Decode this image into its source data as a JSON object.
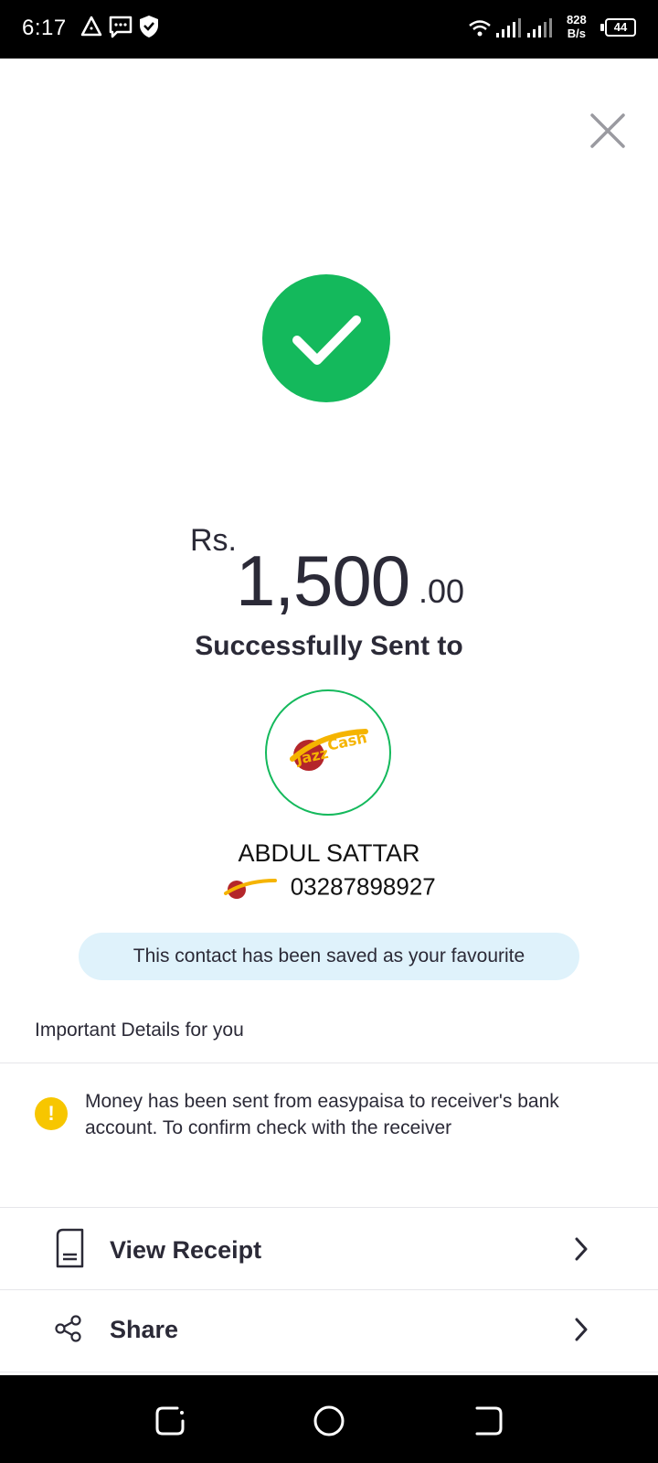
{
  "status_bar": {
    "time": "6:17",
    "net_speed_value": "828",
    "net_speed_unit": "B/s",
    "battery": "44"
  },
  "icons": {
    "close": "close-icon",
    "success": "checkmark-icon",
    "receipt": "receipt-icon",
    "share": "share-icon",
    "chevron": "chevron-right-icon",
    "warning": "warning-icon"
  },
  "amount": {
    "currency": "Rs.",
    "main": "1,500",
    "decimal": ".00"
  },
  "title": "Successfully Sent to",
  "receiver": {
    "name": "ABDUL SATTAR",
    "account": "03287898927",
    "provider_logo": "JazzCash"
  },
  "favourite_message": "This contact has been saved as your favourite",
  "details": {
    "heading": "Important Details for you",
    "warning_symbol": "!",
    "message": "Money has been sent from easypaisa to receiver's bank account. To confirm check with the receiver"
  },
  "actions": [
    {
      "label": "View Receipt"
    },
    {
      "label": "Share"
    }
  ],
  "colors": {
    "success": "#14b95c",
    "pill_bg": "#dff2fb",
    "warning": "#f7c600",
    "text": "#2b2a37"
  }
}
